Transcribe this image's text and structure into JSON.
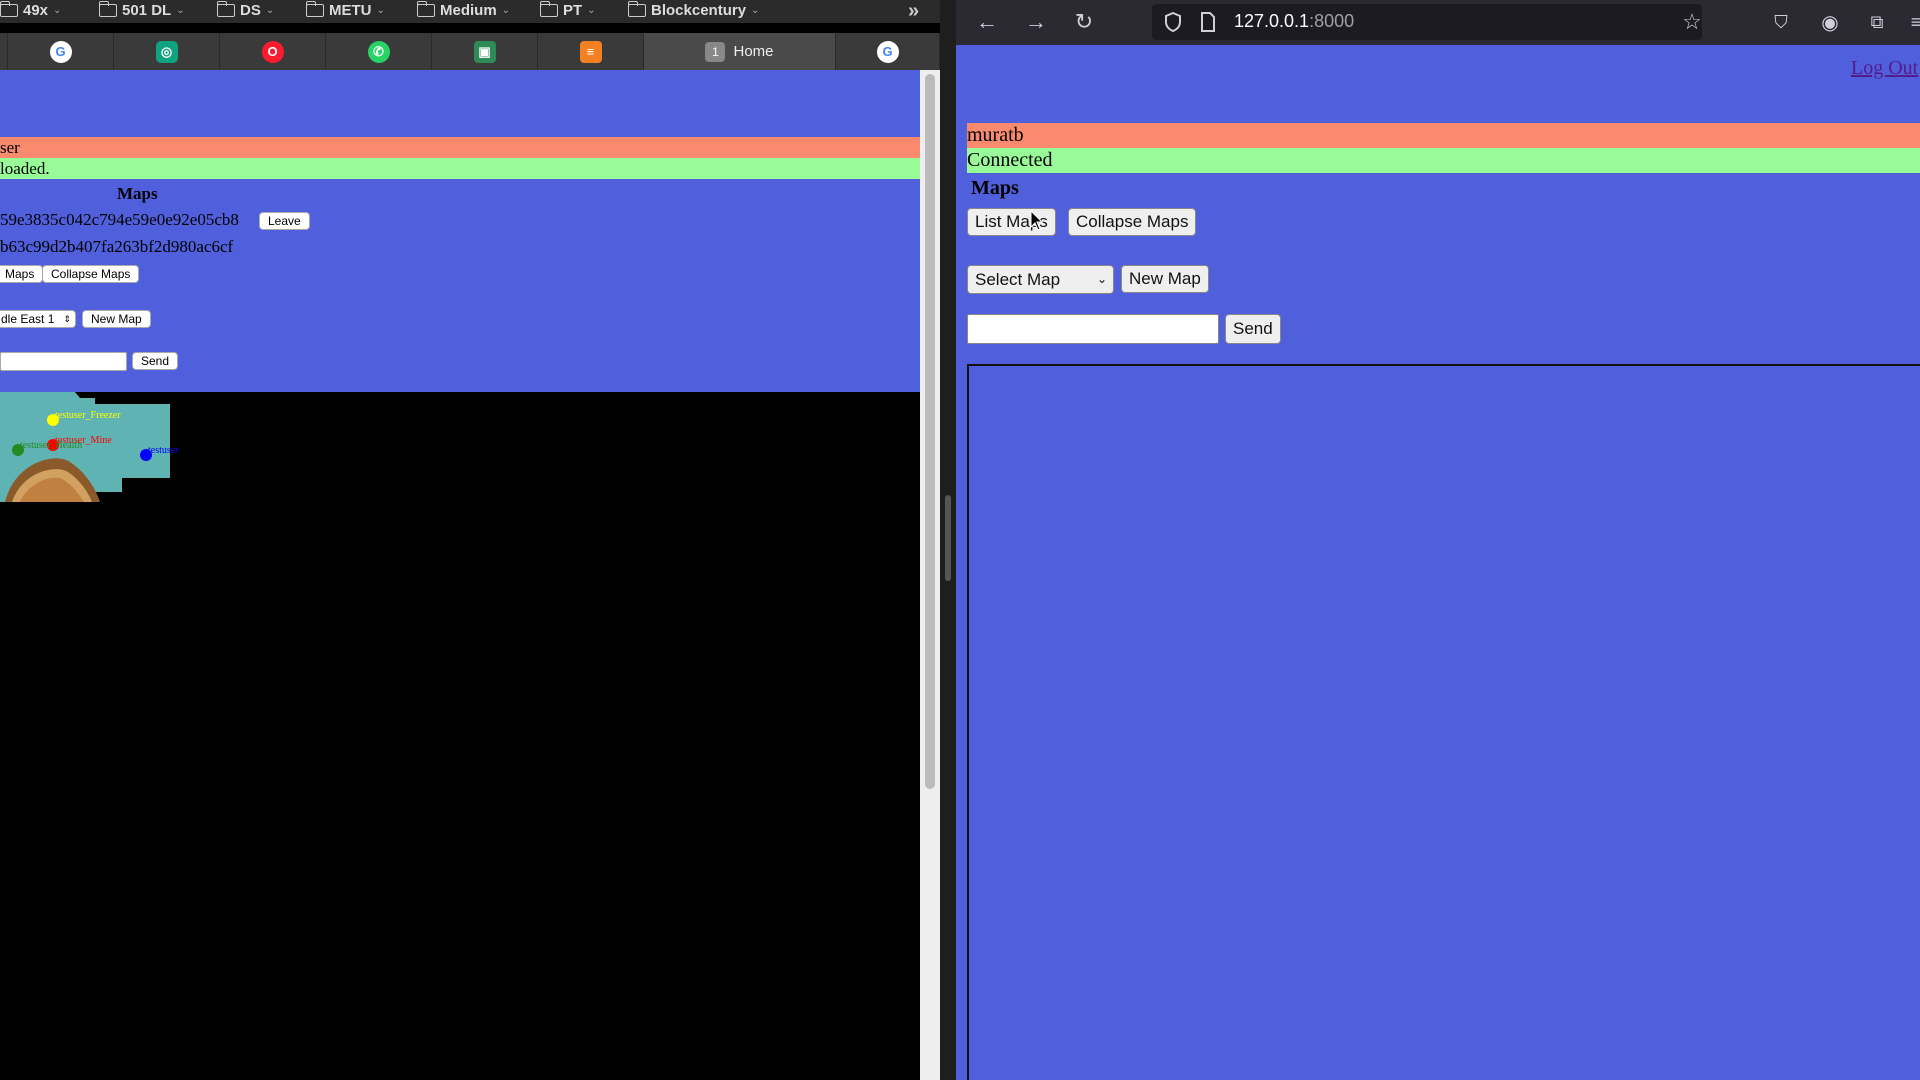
{
  "left_window": {
    "bookmarks": [
      {
        "label": "49x"
      },
      {
        "label": "501 DL"
      },
      {
        "label": "DS"
      },
      {
        "label": "METU"
      },
      {
        "label": "Medium"
      },
      {
        "label": "PT"
      },
      {
        "label": "Blockcentury"
      }
    ],
    "tabs": [
      {
        "icon": "google-icon",
        "color": "#4285f4",
        "glyph": "G"
      },
      {
        "icon": "chatgpt-icon",
        "color": "#10a37f",
        "glyph": "◎"
      },
      {
        "icon": "opera-icon",
        "color": "#ff1b2d",
        "glyph": "O"
      },
      {
        "icon": "whatsapp-icon",
        "color": "#25d366",
        "glyph": "✆"
      },
      {
        "icon": "app-icon",
        "color": "#2e8b57",
        "glyph": "▣"
      },
      {
        "icon": "stackoverflow-icon",
        "color": "#f48024",
        "glyph": "≡"
      }
    ],
    "home_tab": {
      "number": "1",
      "label": "Home"
    },
    "last_tab": {
      "icon": "google-icon",
      "glyph": "G"
    },
    "page": {
      "user_band": "ser",
      "status_band": "loaded.",
      "maps_heading": "Maps",
      "map_id_1": "59e3835c042c794e59e0e92e05cb8",
      "leave_label": "Leave",
      "map_id_2": "b63c99d2b407fa263bf2d980ac6cf",
      "list_maps_label": "Maps",
      "collapse_maps_label": "Collapse Maps",
      "select_value": "dle East 1",
      "new_map_label": "New Map",
      "send_label": "Send",
      "players": [
        {
          "name": "testuser_Freezer",
          "color": "#ffff00"
        },
        {
          "name": "testuser_Mine",
          "color": "#ff0000"
        },
        {
          "name": "testuser_Health",
          "color": "#228b22"
        },
        {
          "name": "testuser",
          "color": "#0000ff"
        }
      ]
    }
  },
  "right_window": {
    "url": "127.0.0.1",
    "url_port": ":8000",
    "page": {
      "logout_label": "Log Out",
      "user_band": "muratb",
      "status_band": "Connected",
      "maps_heading": "Maps",
      "list_maps_label": "List Maps",
      "collapse_maps_label": "Collapse Maps",
      "select_value": "Select Map",
      "new_map_label": "New Map",
      "send_label": "Send"
    }
  },
  "colors": {
    "page_blue": "#5060dc",
    "user_band": "#f98a6e",
    "status_band": "#98fb98"
  }
}
